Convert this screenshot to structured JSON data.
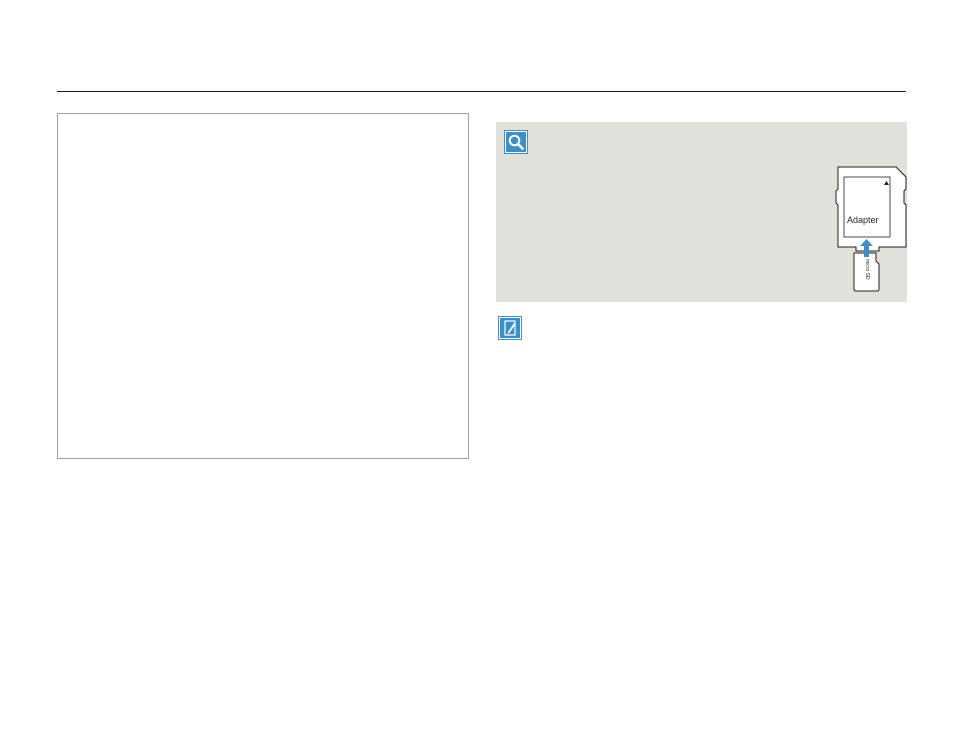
{
  "icons": {
    "info": "search-icon",
    "note": "note-pencil-icon"
  },
  "illustration": {
    "adapter_label": "Adapter",
    "micro_card_text": "micro SD"
  },
  "colors": {
    "rule": "#231f20",
    "box_border": "#a79e8c",
    "panel_bg": "#e1e0da",
    "icon_blue": "#3d8fc8"
  }
}
